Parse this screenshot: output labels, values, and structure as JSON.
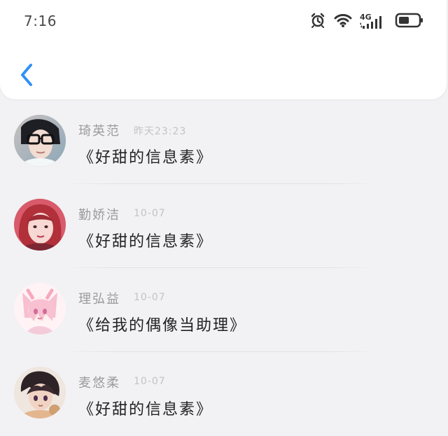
{
  "status_bar": {
    "time": "7:16",
    "network": "4G"
  },
  "messages": [
    {
      "name": "琦英范",
      "date": "昨天23:23",
      "text": "《好甜的信息素》"
    },
    {
      "name": "勤娇洁",
      "date": "10-07",
      "text": "《好甜的信息素》"
    },
    {
      "name": "理弘益",
      "date": "10-07",
      "text": "《给我的偶像当助理》"
    },
    {
      "name": "麦悠柔",
      "date": "10-07",
      "text": "《好甜的信息素》"
    }
  ]
}
